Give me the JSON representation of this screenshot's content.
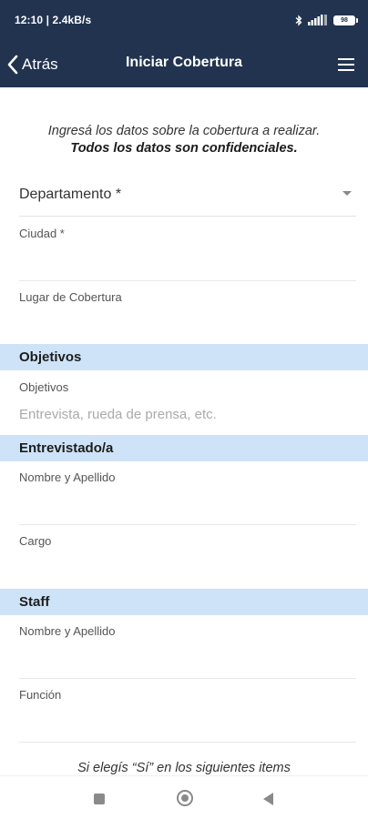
{
  "status_bar": {
    "time_speed": "12:10 | 2.4kB/s",
    "battery": "98"
  },
  "header": {
    "back_label": "Atrás",
    "title": "Iniciar Cobertura"
  },
  "intro": {
    "line1": "Ingresá los datos sobre la cobertura a realizar.",
    "line2": "Todos los datos son confidenciales."
  },
  "form": {
    "departamento_label": "Departamento *",
    "ciudad_label": "Ciudad *",
    "lugar_label": "Lugar de Cobertura"
  },
  "sections": {
    "objetivos": {
      "title": "Objetivos",
      "field_label": "Objetivos",
      "placeholder": "Entrevista, rueda de prensa, etc."
    },
    "entrevistado": {
      "title": "Entrevistado/a",
      "nombre_label": "Nombre y Apellido",
      "cargo_label": "Cargo"
    },
    "staff": {
      "title": "Staff",
      "nombre_label": "Nombre y Apellido",
      "funcion_label": "Función"
    }
  },
  "footer_note": "Si elegís “Sí” en los siguientes items",
  "icons": {
    "back": "chevron-left-icon",
    "menu": "hamburger-menu-icon",
    "bluetooth": "bluetooth-icon",
    "signal": "signal-icon",
    "battery": "battery-icon"
  },
  "colors": {
    "header_bg": "#21334f",
    "section_bg": "#cfe3f8"
  }
}
